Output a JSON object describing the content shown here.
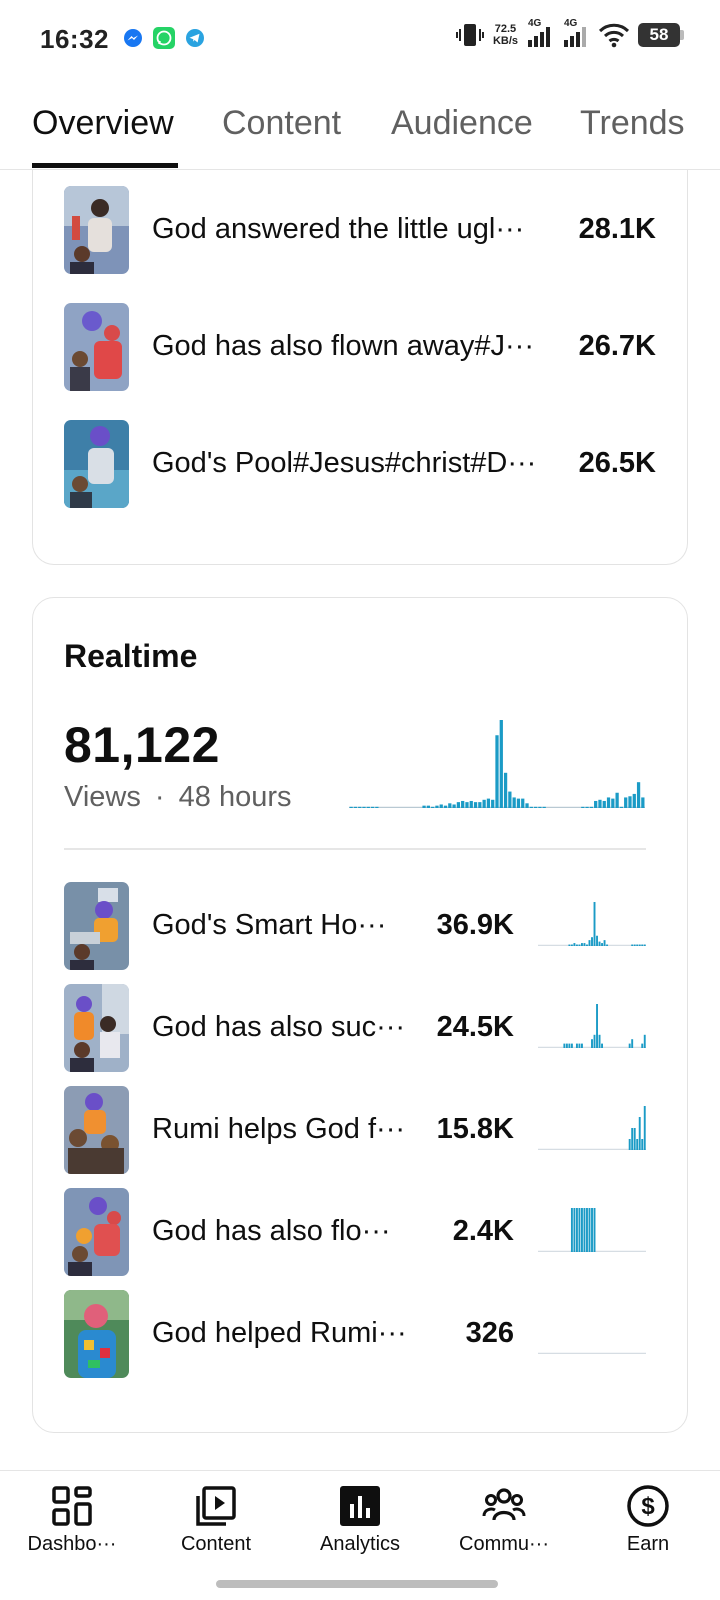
{
  "status_bar": {
    "time": "16:32",
    "net_speed_value": "72.5",
    "net_speed_unit": "KB/s",
    "signal1_label": "4G",
    "signal2_label": "4G",
    "battery": "58",
    "app_icons": [
      "messenger-icon",
      "whatsapp-icon",
      "telegram-icon"
    ]
  },
  "tabs": [
    {
      "label": "Overview",
      "active": true
    },
    {
      "label": "Content",
      "active": false
    },
    {
      "label": "Audience",
      "active": false
    },
    {
      "label": "Trends",
      "active": false
    }
  ],
  "top_content": {
    "items": [
      {
        "title": "God answered the little ugl···",
        "value": "28.1K"
      },
      {
        "title": "God has also flown away#J···",
        "value": "26.7K"
      },
      {
        "title": "God's Pool#Jesus#christ#D···",
        "value": "26.5K"
      }
    ]
  },
  "realtime": {
    "title": "Realtime",
    "views": "81,122",
    "views_label": "Views",
    "separator": "·",
    "period": "48 hours",
    "items": [
      {
        "title": "God's Smart Ho···",
        "value": "36.9K"
      },
      {
        "title": "God has also suc···",
        "value": "24.5K"
      },
      {
        "title": "Rumi helps God f···",
        "value": "15.8K"
      },
      {
        "title": "God has also flo···",
        "value": "2.4K"
      },
      {
        "title": "God helped Rumi···",
        "value": "326"
      }
    ]
  },
  "chart_data": {
    "type": "bar",
    "title": "",
    "xlabel": "",
    "ylabel": "",
    "series": [
      {
        "values": [
          1,
          1,
          1,
          1,
          1,
          1,
          1,
          0,
          0,
          0,
          0,
          0,
          0,
          0,
          0,
          0,
          0,
          2,
          2,
          1,
          2,
          3,
          2,
          4,
          3,
          5,
          6,
          5,
          6,
          5,
          5,
          7,
          8,
          7,
          62,
          75,
          30,
          14,
          9,
          8,
          8,
          4,
          1,
          1,
          1,
          1,
          0,
          0,
          0,
          0,
          0,
          0,
          0,
          0,
          1,
          1,
          1,
          6,
          7,
          6,
          9,
          8,
          13,
          1,
          9,
          10,
          12,
          22,
          9
        ]
      }
    ],
    "color": "#1b9bc6"
  },
  "sparklines": [
    [
      0,
      0,
      0,
      0,
      0,
      0,
      0,
      0,
      0,
      0,
      0,
      0,
      1,
      1,
      2,
      1,
      1,
      2,
      2,
      1,
      4,
      6,
      30,
      7,
      3,
      2,
      4,
      1,
      0,
      0,
      0,
      0,
      0,
      0,
      0,
      0,
      0,
      1,
      1,
      1,
      1,
      1,
      1
    ],
    [
      0,
      0,
      0,
      0,
      0,
      0,
      0,
      0,
      0,
      0,
      1,
      1,
      1,
      1,
      0,
      1,
      1,
      1,
      0,
      0,
      0,
      2,
      3,
      10,
      3,
      1,
      0,
      0,
      0,
      0,
      0,
      0,
      0,
      0,
      0,
      0,
      1,
      2,
      0,
      0,
      0,
      1,
      3
    ],
    [
      0,
      0,
      0,
      0,
      0,
      0,
      0,
      0,
      0,
      0,
      0,
      0,
      0,
      0,
      0,
      0,
      0,
      0,
      0,
      0,
      0,
      0,
      0,
      0,
      0,
      0,
      0,
      0,
      0,
      0,
      0,
      0,
      0,
      0,
      0,
      0,
      1,
      2,
      2,
      1,
      3,
      1,
      4
    ],
    [
      0,
      0,
      0,
      0,
      0,
      0,
      0,
      0,
      0,
      0,
      0,
      0,
      0,
      1,
      1,
      1,
      1,
      1,
      1,
      1,
      1,
      1,
      1,
      0,
      0,
      0,
      0,
      0,
      0,
      0,
      0,
      0,
      0,
      0,
      0,
      0,
      0,
      0,
      0,
      0,
      0,
      0,
      0
    ],
    [
      0,
      0,
      0,
      0,
      0,
      0,
      0,
      0,
      0,
      0,
      0,
      0,
      0,
      0,
      0,
      0,
      0,
      0,
      0,
      0,
      0,
      0,
      0,
      0,
      0,
      0,
      0,
      0,
      0,
      0,
      0,
      0,
      0,
      0,
      0,
      0,
      0,
      0,
      0,
      0,
      0,
      0,
      0
    ]
  ],
  "bottom_nav": [
    {
      "label": "Dashbo···",
      "icon": "dashboard-icon"
    },
    {
      "label": "Content",
      "icon": "content-icon"
    },
    {
      "label": "Analytics",
      "icon": "analytics-icon",
      "active": true
    },
    {
      "label": "Commu···",
      "icon": "community-icon"
    },
    {
      "label": "Earn",
      "icon": "earn-icon"
    }
  ]
}
